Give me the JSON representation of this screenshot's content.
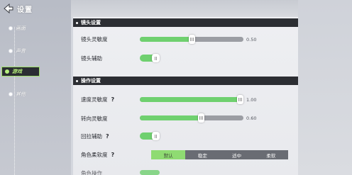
{
  "header": {
    "title": "设置"
  },
  "nav": {
    "items": [
      {
        "label": "画面",
        "active": false
      },
      {
        "label": "声音",
        "active": false
      },
      {
        "label": "游戏",
        "active": true
      },
      {
        "label": "其他",
        "active": false
      }
    ]
  },
  "camera": {
    "title": "镜头设置",
    "sensitivity": {
      "label": "镜头灵敏度",
      "value": "0.50",
      "fraction": 0.5
    },
    "assist": {
      "label": "镜头辅助",
      "on": true
    }
  },
  "controls": {
    "title": "操作设置",
    "speed": {
      "label": "速度灵敏度",
      "value": "1.00",
      "fraction": 1.0
    },
    "turn": {
      "label": "转向灵敏度",
      "value": "0.60",
      "fraction": 0.6
    },
    "correction": {
      "label": "回拉辅助",
      "on": true
    },
    "softness": {
      "label": "角色柔软度",
      "options": [
        "默认",
        "稳定",
        "适中",
        "柔软"
      ],
      "selected": "默认"
    },
    "partial_next": {
      "label": "角色操作"
    }
  },
  "colors": {
    "accent": "#6fd06f",
    "header_bg": "#2c2e33",
    "nav_active_border": "#9fe06a"
  },
  "icons": {
    "back": "back-arrow-icon"
  }
}
